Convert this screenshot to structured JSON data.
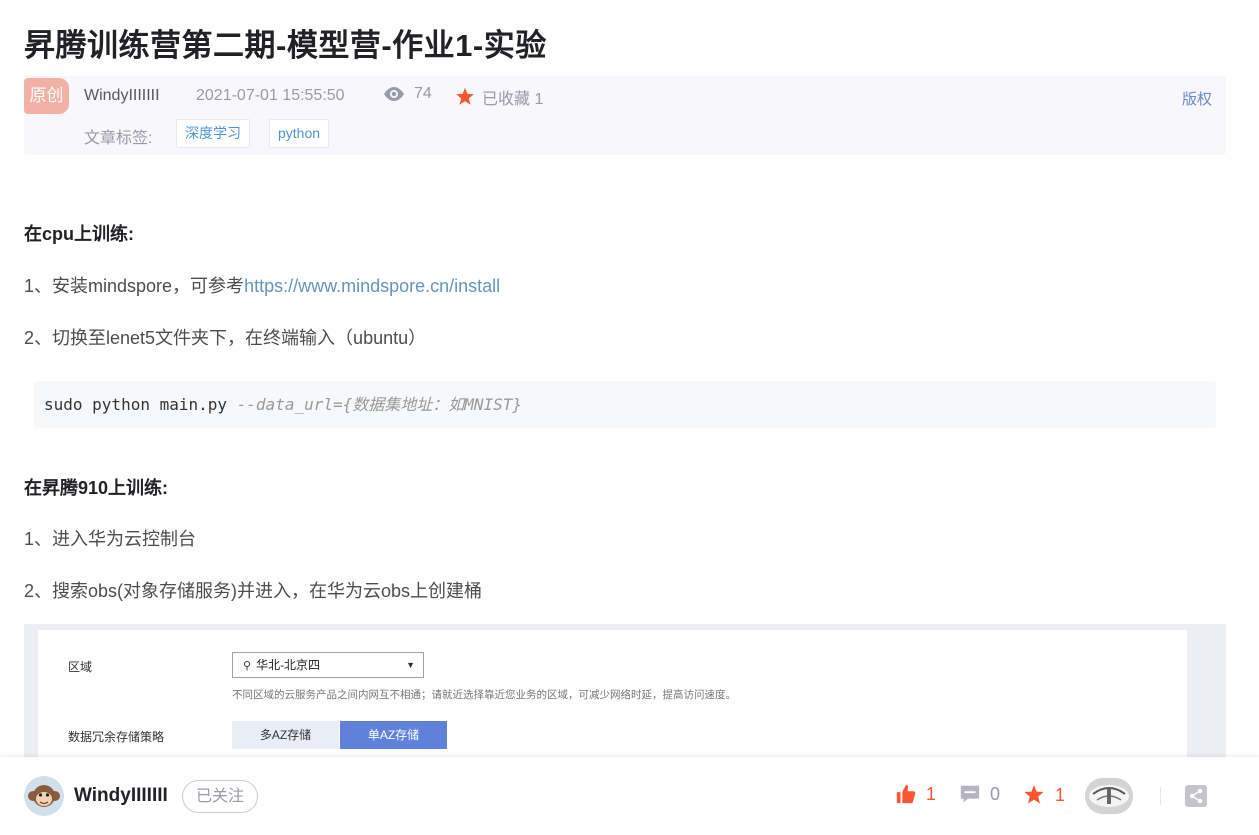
{
  "article": {
    "title": "昇腾训练营第二期-模型营-作业1-实验"
  },
  "meta": {
    "badge": "原创",
    "author": "WindyIIIIIII",
    "datetime": "2021-07-01 15:55:50",
    "views": "74",
    "collected": "已收藏 1",
    "copyright": "版权",
    "tags_label": "文章标签:",
    "tags": [
      "深度学习",
      "python"
    ]
  },
  "content": {
    "cpu_heading": "在cpu上训练:",
    "step1_prefix": "1、安装mindspore，可参考",
    "step1_link": "https://www.mindspore.cn/install",
    "step2": "2、切换至lenet5文件夹下，在终端输入（ubuntu）",
    "code_cmd": "sudo python main.py ",
    "code_comment": "--data_url={数据集地址：如MNIST}",
    "ascend_heading": "在昇腾910上训练:",
    "ascend_step1": "1、进入华为云控制台",
    "ascend_step2": "2、搜索obs(对象存储服务)并进入，在华为云obs上创建桶"
  },
  "screenshot": {
    "region_label": "区域",
    "region_value": "华北-北京四",
    "region_hint": "不同区域的云服务产品之间内网互不相通；请就近选择靠近您业务的区域，可减少网络时延，提高访问速度。",
    "redundancy_label": "数据冗余存储策略",
    "options": [
      "多AZ存储",
      "单AZ存储"
    ]
  },
  "bottom": {
    "author": "WindyIIIIIII",
    "follow": "已关注",
    "likes": "1",
    "comments": "0",
    "collects": "1"
  },
  "colors": {
    "accent": "#fc5531",
    "link": "#6795b5",
    "selected": "#5f80db"
  }
}
